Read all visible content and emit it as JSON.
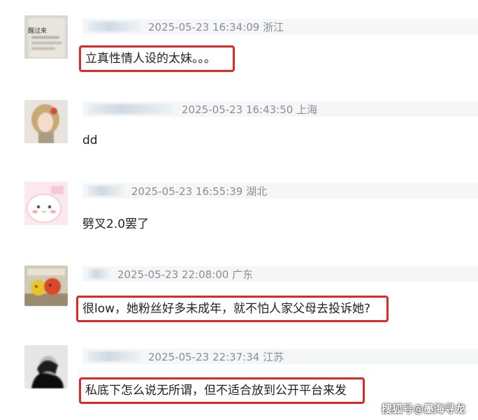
{
  "comments": [
    {
      "timestamp": "2025-05-23 16:34:09",
      "location": "浙江",
      "text": "立真性情人设的太妹。。。",
      "highlighted": true,
      "avatar_icon": "paper-note-avatar-icon",
      "avatar_caption": "醒过来"
    },
    {
      "timestamp": "2025-05-23 16:43:50",
      "location": "上海",
      "text": "dd",
      "highlighted": false,
      "avatar_icon": "painted-woman-avatar-icon"
    },
    {
      "timestamp": "2025-05-23 16:55:39",
      "location": "湖北",
      "text": "劈叉2.0罢了",
      "highlighted": false,
      "avatar_icon": "cute-face-avatar-icon"
    },
    {
      "timestamp": "2025-05-23 22:08:00",
      "location": "广东",
      "text": "很low，她粉丝好多未成年，就不怕人家父母去投诉她?",
      "highlighted": true,
      "avatar_icon": "cartoon-characters-avatar-icon"
    },
    {
      "timestamp": "2025-05-23 22:37:34",
      "location": "江苏",
      "text": "私底下怎么说无所谓，但不适合放到公开平台来发",
      "highlighted": true,
      "avatar_icon": "dark-person-avatar-icon"
    }
  ],
  "watermark": "搜狐号@墨海寻龙",
  "colors": {
    "highlight_border": "#e12828",
    "meta_bg": "#f4f6f7",
    "timestamp": "#8a8f95"
  }
}
